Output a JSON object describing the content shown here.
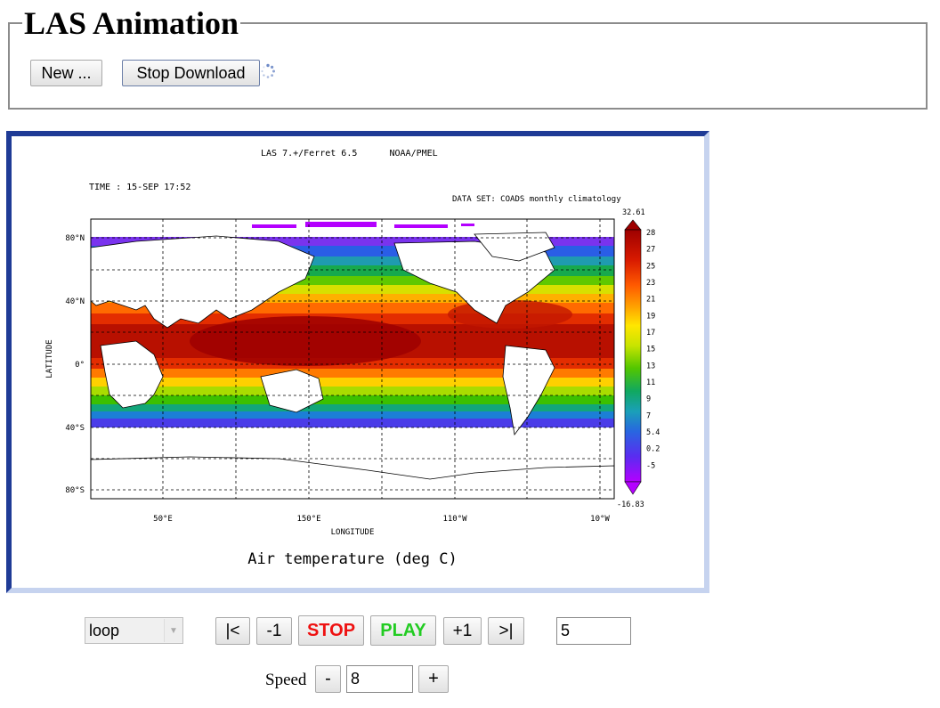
{
  "header": {
    "title": "LAS Animation",
    "new_label": "New ...",
    "stop_download_label": "Stop Download"
  },
  "plot": {
    "top_label": "LAS 7.+/Ferret 6.5      NOAA/PMEL",
    "time_label": "TIME : 15-SEP 17:52",
    "dataset_label": "DATA SET: COADS monthly climatology",
    "y_axis_label": "LATITUDE",
    "x_axis_label": "LONGITUDE",
    "variable_title": "Air temperature (deg C)",
    "lat_ticks": [
      "80°N",
      "40°N",
      "0°",
      "40°S",
      "80°S"
    ],
    "lon_ticks": [
      "50°E",
      "150°E",
      "110°W",
      "10°W"
    ],
    "colorbar_max": "32.61",
    "colorbar_min": "-16.83",
    "colorbar_labels": [
      "28",
      "27",
      "25",
      "23",
      "21",
      "19",
      "17",
      "15",
      "13",
      "11",
      "9",
      "7",
      "5.4",
      "0.2",
      "-5"
    ]
  },
  "controls": {
    "loop_select_value": "loop",
    "first_label": "|<",
    "prev_label": "-1",
    "stop_label": "STOP",
    "play_label": "PLAY",
    "next_label": "+1",
    "last_label": ">|",
    "frame_value": "5",
    "speed_label": "Speed",
    "speed_minus_label": "-",
    "speed_value": "8",
    "speed_plus_label": "+"
  },
  "colors": {
    "frame_border": "#1f3b96",
    "stop_text": "#ee1111",
    "play_text": "#22cc22"
  }
}
